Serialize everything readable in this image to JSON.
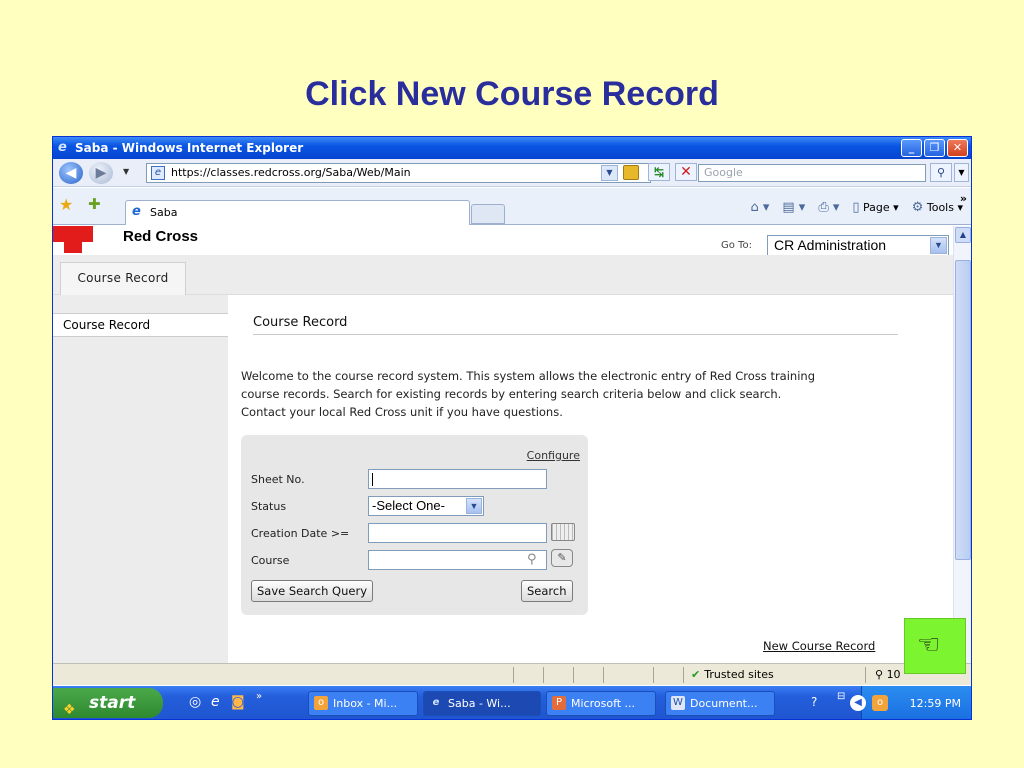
{
  "slide": {
    "title": "Click New Course Record"
  },
  "window": {
    "title": "Saba - Windows Internet Explorer",
    "url": "https://classes.redcross.org/Saba/Web/Main",
    "search_placeholder": "Google",
    "tab_label": "Saba",
    "commands": {
      "page": "Page",
      "tools": "Tools"
    }
  },
  "page": {
    "brand": "Red Cross",
    "goto_label": "Go To:",
    "goto_value": "CR Administration",
    "top_tab": "Course Record",
    "sidebar_items": [
      "Course Record"
    ],
    "heading": "Course Record",
    "welcome_lines": [
      "Welcome to the course record system. This system allows the electronic entry of Red Cross training",
      "course records. Search for existing records by entering search criteria below and click search.",
      "Contact your local Red Cross unit if you have questions."
    ],
    "search": {
      "configure": "Configure",
      "sheet_no_label": "Sheet No.",
      "sheet_no_value": "",
      "status_label": "Status",
      "status_value": "-Select One-",
      "creation_date_label": "Creation Date >=",
      "creation_date_value": "",
      "course_label": "Course",
      "course_value": "",
      "save_query_label": "Save Search Query",
      "search_label": "Search"
    },
    "new_record_link": "New Course Record"
  },
  "statusbar": {
    "zone": "Trusted sites",
    "zoom": "10"
  },
  "taskbar": {
    "start": "start",
    "tasks": [
      "Inbox - Mi...",
      "Saba - Wi...",
      "Microsoft ...",
      "Document..."
    ],
    "clock": "12:59 PM"
  },
  "icons": {
    "pointer": "pointing-hand-icon"
  }
}
